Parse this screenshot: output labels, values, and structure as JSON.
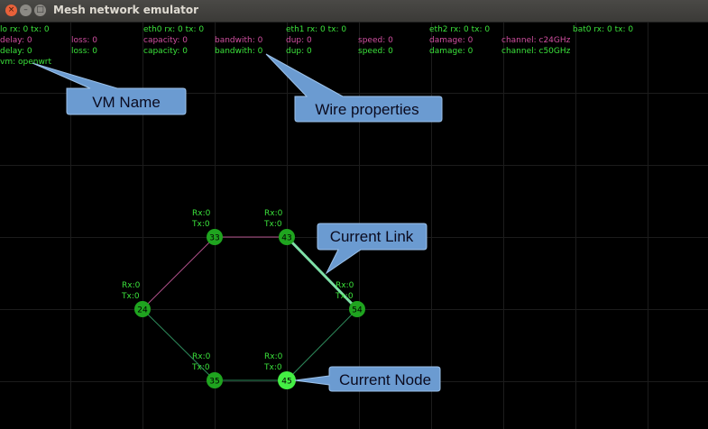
{
  "window": {
    "title": "Mesh network emulator",
    "close_glyph": "×",
    "minimize_glyph": "–",
    "maximize_glyph": "□"
  },
  "info": {
    "lo": "lo rx: 0 tx: 0",
    "eth0": "eth0 rx: 0 tx: 0",
    "eth1": "eth1 rx: 0 tx: 0",
    "eth2": "eth2 rx: 0 tx: 0",
    "bat0": "bat0 rx: 0 tx: 0",
    "row1": {
      "delay": "delay: 0",
      "loss": "loss: 0",
      "capacity": "capacity: 0",
      "bandwith": "bandwith: 0",
      "dup": "dup: 0",
      "speed": "speed: 0",
      "damage": "damage: 0",
      "channel": "channel: c24GHz"
    },
    "row2": {
      "delay": "delay: 0",
      "loss": "loss: 0",
      "capacity": "capacity: 0",
      "bandwith": "bandwith: 0",
      "dup": "dup: 0",
      "speed": "speed: 0",
      "damage": "damage: 0",
      "channel": "channel: c50GHz"
    },
    "vm": "vm: openwrt"
  },
  "nodes": [
    {
      "id": "33",
      "rx": "Rx:0",
      "tx": "Tx:0"
    },
    {
      "id": "43",
      "rx": "Rx:0",
      "tx": "Tx:0"
    },
    {
      "id": "24",
      "rx": "Rx:0",
      "tx": "Tx:0"
    },
    {
      "id": "54",
      "rx": "Rx:0",
      "tx": "Tx:0"
    },
    {
      "id": "35",
      "rx": "Rx:0",
      "tx": "Tx:0"
    },
    {
      "id": "45",
      "rx": "Rx:0",
      "tx": "Tx:0"
    }
  ],
  "callouts": {
    "vm_name": "VM Name",
    "wire_properties": "Wire properties",
    "current_link": "Current Link",
    "current_node": "Current Node"
  },
  "colors": {
    "node": "#1fa41f",
    "node_current": "#44ee44",
    "info_green": "#3be23b",
    "info_pink": "#d04fa0",
    "link_pink": "#b0508a",
    "link_green": "#2e8c5c",
    "link_current": "#7fe0a8",
    "grid": "#1c1c1c",
    "callout_fill": "#6b9bd1"
  }
}
